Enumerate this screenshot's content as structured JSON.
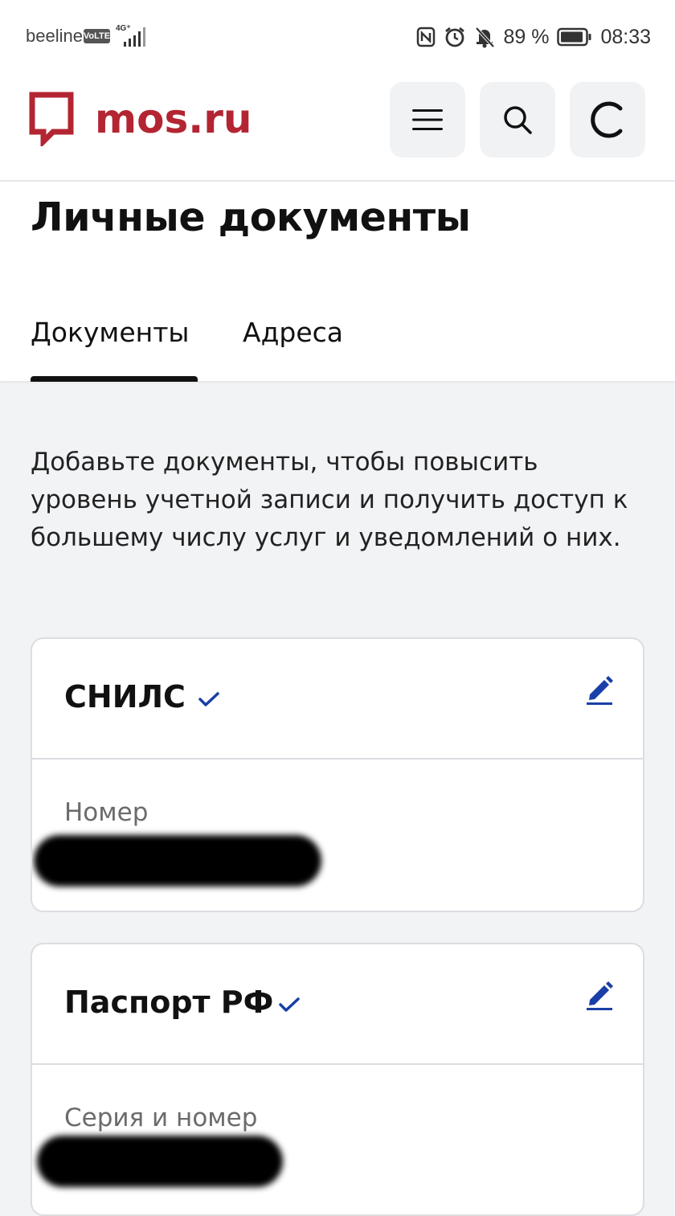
{
  "status_bar": {
    "carrier": "beeline",
    "volte": "VoLTE",
    "network": "4G⁺",
    "battery": "89 %",
    "time": "08:33"
  },
  "header": {
    "logo_text": "mos.ru",
    "brand_color": "#b32532",
    "icons": [
      "menu-icon",
      "search-icon",
      "loading-icon"
    ]
  },
  "page": {
    "title": "Личные документы",
    "tabs": [
      {
        "label": "Документы",
        "active": true
      },
      {
        "label": "Адреса",
        "active": false
      }
    ],
    "intro": "Добавьте документы, чтобы повысить уровень учетной записи и получить доступ к большему числу услуг и уведомлений о них."
  },
  "documents": [
    {
      "title": "СНИЛС",
      "verified": true,
      "field_label": "Номер",
      "value_redacted": true
    },
    {
      "title": "Паспорт РФ",
      "verified": true,
      "field_label": "Серия и номер",
      "value_redacted": true
    }
  ],
  "colors": {
    "accent": "#1a3fa8"
  }
}
